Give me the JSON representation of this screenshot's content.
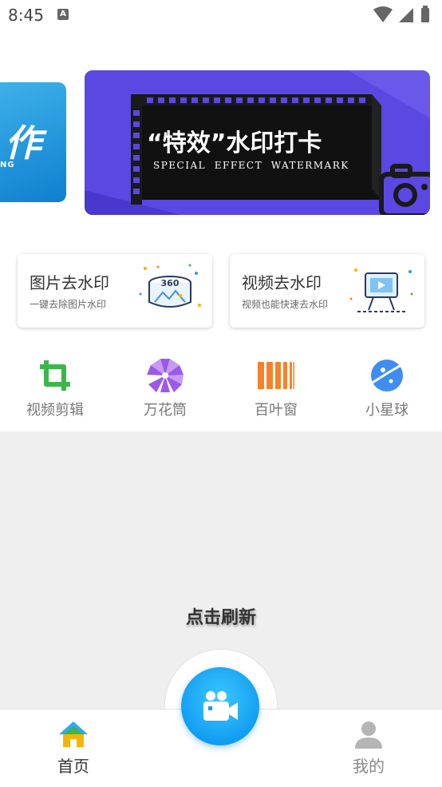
{
  "status_bar": {
    "time": "8:45",
    "notif": "A"
  },
  "banner": {
    "prev_big": "作",
    "prev_small": "NG",
    "title": "“特效”水印打卡",
    "subtitle": "SPECIAL  EFFECT  WATERMARK"
  },
  "cards": [
    {
      "title": "图片去水印",
      "subtitle": "一键去除图片水印",
      "badge": "360"
    },
    {
      "title": "视频去水印",
      "subtitle": "视频也能快速去水印"
    }
  ],
  "tools": [
    {
      "label": "视频剪辑",
      "icon": "crop-icon",
      "color": "#3cb54a"
    },
    {
      "label": "万花筒",
      "icon": "kaleidoscope-icon",
      "color": "#9b59e8"
    },
    {
      "label": "百叶窗",
      "icon": "blinds-icon",
      "color": "#f5822a"
    },
    {
      "label": "小星球",
      "icon": "planet-icon",
      "color": "#3f8df0"
    }
  ],
  "content": {
    "refresh_label": "点击刷新"
  },
  "bottom_nav": {
    "home_label": "首页",
    "mine_label": "我的",
    "fab_icon": "video-camera-icon"
  }
}
